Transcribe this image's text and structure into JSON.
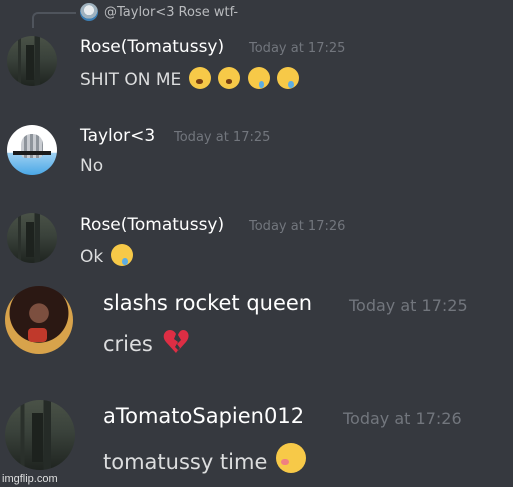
{
  "reply": {
    "author": "@Taylor<3",
    "text": "Rose wtf-"
  },
  "messages": [
    {
      "author": "Rose(Tomatussy)",
      "timestamp": "Today at 17:25",
      "text": "SHIT ON ME",
      "emojis": [
        "weary-face-emoji",
        "weary-face-emoji",
        "drooling-face-emoji",
        "drooling-face-emoji"
      ]
    },
    {
      "author": "Taylor<3",
      "timestamp": "Today at 17:25",
      "text": "No"
    },
    {
      "author": "Rose(Tomatussy)",
      "timestamp": "Today at 17:26",
      "text": "Ok",
      "emojis": [
        "drooling-face-emoji"
      ]
    },
    {
      "author": "slashs rocket queen",
      "timestamp": "Today at 17:25",
      "text": "cries",
      "emojis": [
        "broken-heart-emoji"
      ]
    },
    {
      "author": "aTomatoSapien012",
      "timestamp": "Today at 17:26",
      "text": "tomatussy time",
      "emojis": [
        "woozy-face-emoji"
      ]
    }
  ],
  "watermark": "imgflip.com",
  "colors": {
    "background": "#36393f",
    "username": "#ffffff",
    "timestamp": "#72767d",
    "message_text": "#dcddde",
    "emoji_yellow": "#f7c948",
    "heart_red": "#dd2e44"
  }
}
